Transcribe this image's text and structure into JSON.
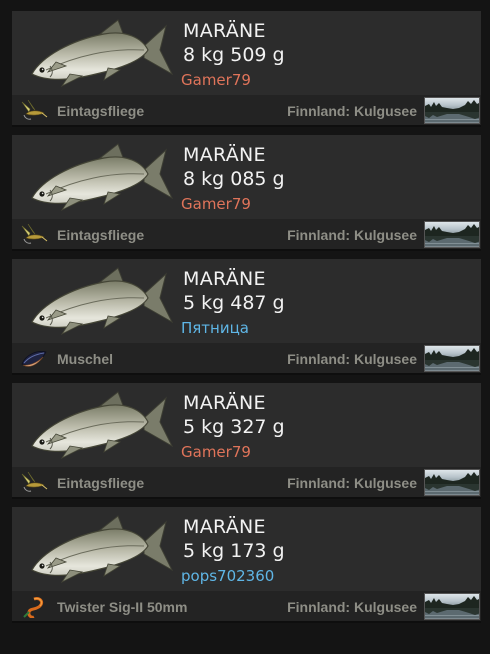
{
  "colors": {
    "card_bg": "#2c2c2c",
    "footer_bg": "#232323",
    "text_primary": "#f2f2f2",
    "text_secondary": "#8e8e86",
    "player_orange": "#e0745a",
    "player_blue": "#5fb6e6"
  },
  "catches": [
    {
      "fish_icon": "whitefish-icon",
      "fish": "MARÄNE",
      "weight": "8 kg 509 g",
      "player": "Gamer79",
      "player_color": "#e0745a",
      "bait_icon": "mayfly-lure-icon",
      "bait": "Eintagsfliege",
      "location": "Finnland: Kulgusee",
      "location_icon": "lake-thumbnail"
    },
    {
      "fish_icon": "whitefish-icon",
      "fish": "MARÄNE",
      "weight": "8 kg 085 g",
      "player": "Gamer79",
      "player_color": "#e0745a",
      "bait_icon": "mayfly-lure-icon",
      "bait": "Eintagsfliege",
      "location": "Finnland: Kulgusee",
      "location_icon": "lake-thumbnail"
    },
    {
      "fish_icon": "whitefish-icon",
      "fish": "MARÄNE",
      "weight": "5 kg 487 g",
      "player": "Пятница",
      "player_color": "#5fb6e6",
      "bait_icon": "mussel-bait-icon",
      "bait": "Muschel",
      "location": "Finnland: Kulgusee",
      "location_icon": "lake-thumbnail"
    },
    {
      "fish_icon": "whitefish-icon",
      "fish": "MARÄNE",
      "weight": "5 kg 327 g",
      "player": "Gamer79",
      "player_color": "#e0745a",
      "bait_icon": "mayfly-lure-icon",
      "bait": "Eintagsfliege",
      "location": "Finnland: Kulgusee",
      "location_icon": "lake-thumbnail"
    },
    {
      "fish_icon": "whitefish-icon",
      "fish": "MARÄNE",
      "weight": "5 kg 173 g",
      "player": "pops702360",
      "player_color": "#5fb6e6",
      "bait_icon": "twister-lure-icon",
      "bait": "Twister Sig-II 50mm",
      "location": "Finnland: Kulgusee",
      "location_icon": "lake-thumbnail"
    }
  ]
}
